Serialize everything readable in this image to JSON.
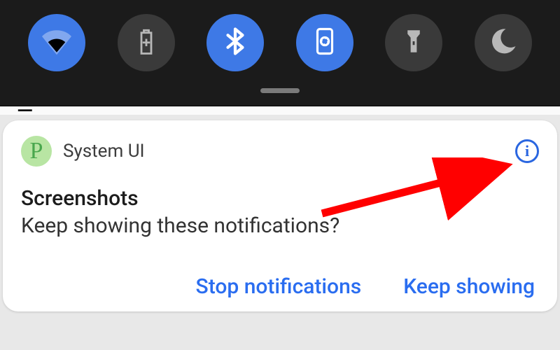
{
  "quick_settings": {
    "tiles": [
      {
        "name": "wifi",
        "active": true
      },
      {
        "name": "battery",
        "active": false
      },
      {
        "name": "bluetooth",
        "active": true
      },
      {
        "name": "screenshot",
        "active": true
      },
      {
        "name": "flashlight",
        "active": false
      },
      {
        "name": "dnd",
        "active": false
      }
    ]
  },
  "notification": {
    "app_name": "System UI",
    "title": "Screenshots",
    "body": "Keep showing these notifications?",
    "action_stop": "Stop notifications",
    "action_keep": "Keep showing",
    "info_glyph": "i",
    "app_glyph": "P"
  },
  "annotation": {
    "arrow_target": "notification-info-icon",
    "color": "#ff0000"
  }
}
